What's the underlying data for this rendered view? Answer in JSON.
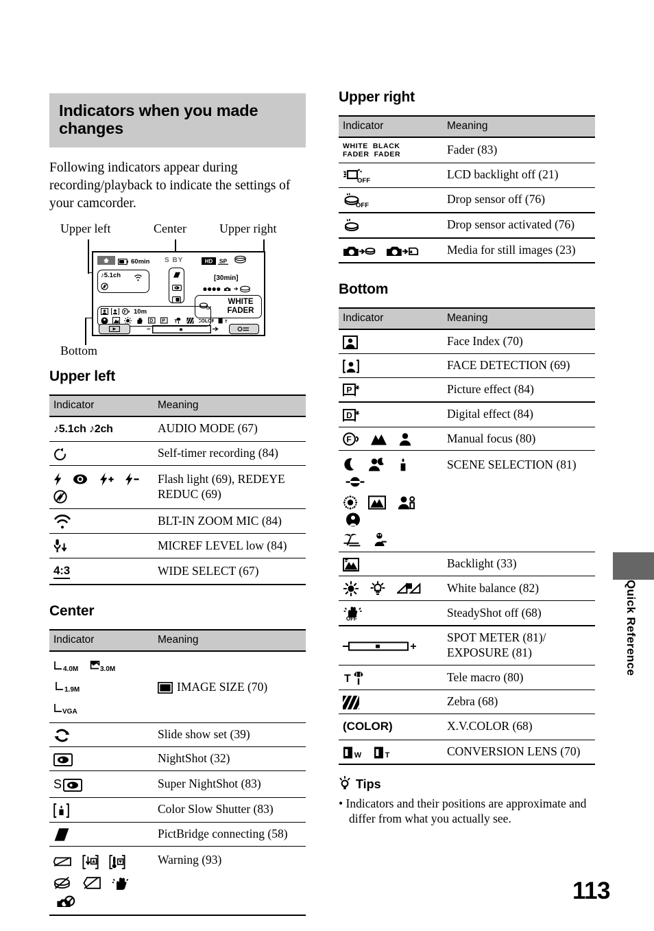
{
  "page": {
    "number": "113",
    "side_tab": "Quick Reference"
  },
  "heading": {
    "title": "Indicators when you made changes",
    "intro": "Following indicators appear during recording/playback to indicate the settings of your camcorder."
  },
  "diagram": {
    "labels": {
      "upper_left": "Upper left",
      "center": "Center",
      "upper_right": "Upper right",
      "bottom": "Bottom"
    },
    "lcd": {
      "battery_time": "60min",
      "standby": "S BY",
      "format": "HD",
      "quality": "SP",
      "remaining": "[30min]",
      "audio": "5.1ch",
      "fader_line1": "WHITE",
      "fader_line2": "FADER",
      "focus_distance": "10m"
    }
  },
  "tables": {
    "upper_left": {
      "title": "Upper left",
      "columns": [
        "Indicator",
        "Meaning"
      ],
      "rows": [
        {
          "indicator_icons": [
            "note-5.1ch",
            "note-2ch"
          ],
          "indicator_text": "♪5.1ch ♪2ch",
          "meaning": "AUDIO MODE (67)"
        },
        {
          "indicator_icons": [
            "self-timer"
          ],
          "indicator_text": "",
          "meaning": "Self-timer recording (84)"
        },
        {
          "indicator_icons": [
            "flash",
            "redeye",
            "flash-plus",
            "flash-minus",
            "flash-off"
          ],
          "indicator_text": "",
          "meaning": "Flash light (69), REDEYE REDUC (69)"
        },
        {
          "indicator_icons": [
            "zoom-mic"
          ],
          "indicator_text": "",
          "meaning": "BLT-IN ZOOM MIC (84)"
        },
        {
          "indicator_icons": [
            "micref-low"
          ],
          "indicator_text": "",
          "meaning": "MICREF LEVEL low (84)"
        },
        {
          "indicator_icons": [
            "aspect-4-3"
          ],
          "indicator_text": "4:3",
          "meaning": "WIDE SELECT (67)"
        }
      ]
    },
    "center": {
      "title": "Center",
      "columns": [
        "Indicator",
        "Meaning"
      ],
      "rows": [
        {
          "indicator_icons": [
            "size-4.0M",
            "size-3.0M",
            "size-1.9M",
            "size-VGA"
          ],
          "indicator_text": "4.0M 3.0M 1.9M VGA",
          "meaning": "IMAGE SIZE (70)",
          "meaning_icon": "image-size-icon"
        },
        {
          "indicator_icons": [
            "slideshow-loop"
          ],
          "indicator_text": "",
          "meaning": "Slide show set (39)"
        },
        {
          "indicator_icons": [
            "nightshot"
          ],
          "indicator_text": "",
          "meaning": "NightShot (32)"
        },
        {
          "indicator_icons": [
            "super-nightshot"
          ],
          "indicator_text": "S",
          "meaning": "Super NightShot (83)"
        },
        {
          "indicator_icons": [
            "color-slow-shutter"
          ],
          "indicator_text": "",
          "meaning": "Color Slow Shutter (83)"
        },
        {
          "indicator_icons": [
            "pictbridge"
          ],
          "indicator_text": "",
          "meaning": "PictBridge connecting (58)"
        },
        {
          "indicator_icons": [
            "battery-warn",
            "media-warn",
            "temp-warn",
            "disc-warn",
            "lcd-warn",
            "shake-warn",
            "flash-warn"
          ],
          "indicator_text": "",
          "meaning": "Warning (93)"
        }
      ]
    },
    "upper_right": {
      "title": "Upper right",
      "columns": [
        "Indicator",
        "Meaning"
      ],
      "rows": [
        {
          "indicator_icons": [
            "white-fader",
            "black-fader"
          ],
          "indicator_text": "WHITE FADER BLACK FADER",
          "meaning": "Fader (83)"
        },
        {
          "indicator_icons": [
            "lcd-backlight-off"
          ],
          "indicator_text": "OFF",
          "meaning": "LCD backlight off (21)"
        },
        {
          "indicator_icons": [
            "drop-sensor-off"
          ],
          "indicator_text": "OFF",
          "meaning": "Drop sensor off (76)"
        },
        {
          "indicator_icons": [
            "drop-sensor-on"
          ],
          "indicator_text": "",
          "meaning": "Drop sensor activated (76)"
        },
        {
          "indicator_icons": [
            "still-to-disc",
            "still-to-memcard"
          ],
          "indicator_text": "",
          "meaning": "Media for still images (23)"
        }
      ]
    },
    "bottom": {
      "title": "Bottom",
      "columns": [
        "Indicator",
        "Meaning"
      ],
      "rows": [
        {
          "indicator_icons": [
            "face-index"
          ],
          "indicator_text": "",
          "meaning": "Face Index (70)"
        },
        {
          "indicator_icons": [
            "face-detection"
          ],
          "indicator_text": "",
          "meaning": "FACE DETECTION (69)"
        },
        {
          "indicator_icons": [
            "picture-effect"
          ],
          "indicator_text": "P",
          "meaning": "Picture effect (84)"
        },
        {
          "indicator_icons": [
            "digital-effect"
          ],
          "indicator_text": "D",
          "meaning": "Digital effect (84)"
        },
        {
          "indicator_icons": [
            "manual-focus",
            "mountain-focus",
            "person-focus"
          ],
          "indicator_text": "",
          "meaning": "Manual focus (80)"
        },
        {
          "indicator_icons": [
            "twilight",
            "twilight-portrait",
            "candle",
            "sunrise-sunset",
            "fireworks",
            "landscape",
            "portrait",
            "spotlight",
            "beach",
            "snow"
          ],
          "indicator_text": "",
          "meaning": "SCENE SELECTION (81)"
        },
        {
          "indicator_icons": [
            "backlight"
          ],
          "indicator_text": "",
          "meaning": "Backlight (33)"
        },
        {
          "indicator_icons": [
            "wb-outdoor",
            "wb-indoor",
            "wb-onepush"
          ],
          "indicator_text": "",
          "meaning": "White balance (82)"
        },
        {
          "indicator_icons": [
            "steadyshot-off"
          ],
          "indicator_text": "OFF",
          "meaning": "SteadyShot off (68)"
        },
        {
          "indicator_icons": [
            "exposure-slider"
          ],
          "indicator_text": "",
          "meaning": "SPOT METER (81)/ EXPOSURE (81)"
        },
        {
          "indicator_icons": [
            "tele-macro"
          ],
          "indicator_text": "T",
          "meaning": "Tele macro (80)"
        },
        {
          "indicator_icons": [
            "zebra"
          ],
          "indicator_text": "",
          "meaning": "Zebra (68)"
        },
        {
          "indicator_icons": [
            "xv-color"
          ],
          "indicator_text": "(COLOR)",
          "meaning": "X.V.COLOR (68)"
        },
        {
          "indicator_icons": [
            "conversion-lens-wide",
            "conversion-lens-tele"
          ],
          "indicator_text": "W T",
          "meaning": "CONVERSION LENS (70)"
        }
      ]
    }
  },
  "tips": {
    "title": "Tips",
    "items": [
      "Indicators and their positions are approximate and differ from what you actually see."
    ]
  },
  "colors": {
    "heading_band": "#c9c9c9",
    "table_header": "#c9c9c9",
    "side_tab_block": "#666666",
    "rule": "#000000"
  }
}
